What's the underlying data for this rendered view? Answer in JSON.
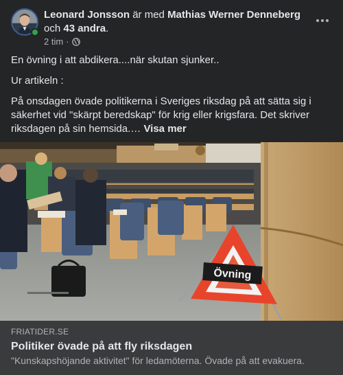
{
  "post": {
    "author": "Leonard Jonsson",
    "with_text": " är med ",
    "tagged": "Mathias Werner Denneberg",
    "and_text": "och ",
    "others": "43 andra",
    "period": ".",
    "time": "2 tim",
    "dot": "·",
    "audience_icon": "globe-icon",
    "more_icon": "more-horizontal-icon",
    "paragraphs": [
      "En övning i att abdikera....när skutan sjunker..",
      "Ur artikeln :",
      "På onsdagen övade politikerna i Sveriges riksdag på att sätta sig i säkerhet vid \"skärpt beredskap\" för krig eller krigsfara. Det skriver riksdagen på sin hemsida.… "
    ],
    "see_more": "Visa mer"
  },
  "photo": {
    "sign_text": "Övning"
  },
  "link": {
    "domain": "FRIATIDER.SE",
    "title": "Politiker övade på att fly riksdagen",
    "description": "\"Kunskapshöjande aktivitet\" för ledamöterna. Övade på att evakuera."
  },
  "colors": {
    "background": "#242526",
    "preview_background": "#3a3b3c",
    "primary_text": "#e4e6eb",
    "secondary_text": "#b0b3b8",
    "online": "#31a24c",
    "sign_red": "#e8442c"
  }
}
